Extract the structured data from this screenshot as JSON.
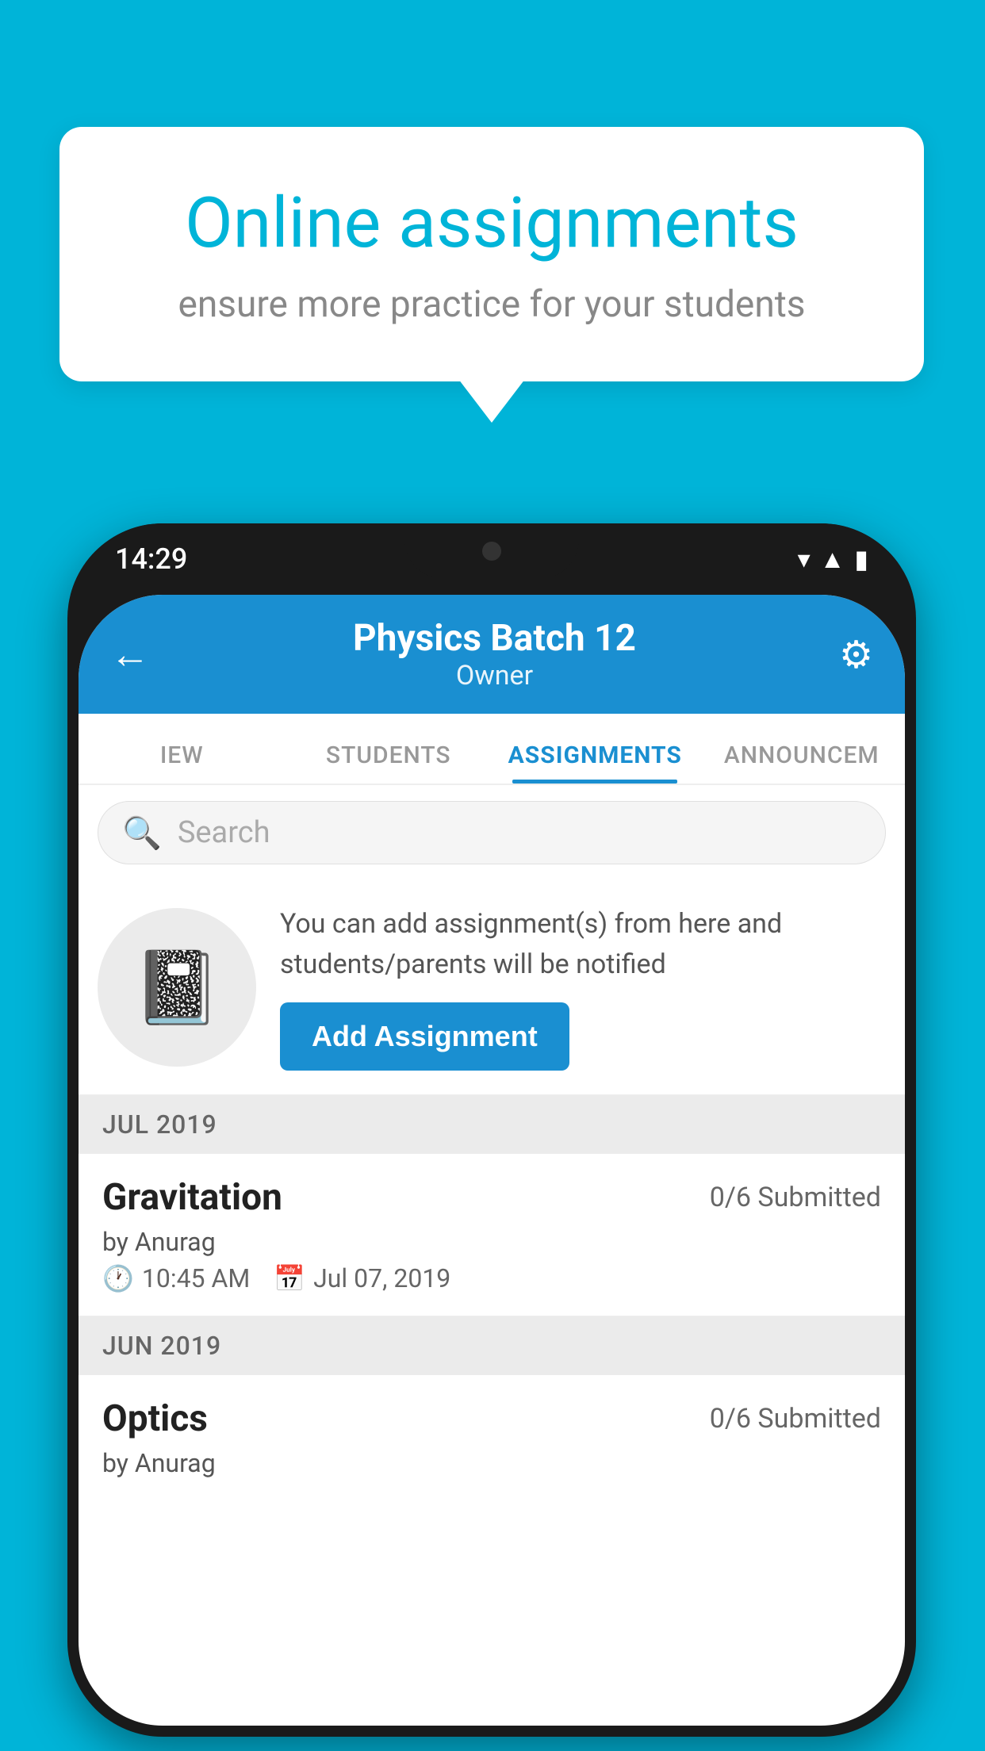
{
  "background_color": "#00b4d8",
  "speech_bubble": {
    "title": "Online assignments",
    "subtitle": "ensure more practice for your students"
  },
  "phone": {
    "status_bar": {
      "time": "14:29"
    },
    "header": {
      "title": "Physics Batch 12",
      "subtitle": "Owner",
      "back_label": "←",
      "settings_label": "⚙"
    },
    "tabs": [
      {
        "label": "IEW",
        "active": false
      },
      {
        "label": "STUDENTS",
        "active": false
      },
      {
        "label": "ASSIGNMENTS",
        "active": true
      },
      {
        "label": "ANNOUNCEM",
        "active": false
      }
    ],
    "search": {
      "placeholder": "Search"
    },
    "promo": {
      "description": "You can add assignment(s) from here and students/parents will be notified",
      "button_label": "Add Assignment"
    },
    "sections": [
      {
        "header": "JUL 2019",
        "assignments": [
          {
            "name": "Gravitation",
            "submitted": "0/6 Submitted",
            "by": "by Anurag",
            "time": "10:45 AM",
            "date": "Jul 07, 2019"
          }
        ]
      },
      {
        "header": "JUN 2019",
        "assignments": [
          {
            "name": "Optics",
            "submitted": "0/6 Submitted",
            "by": "by Anurag",
            "time": "",
            "date": ""
          }
        ]
      }
    ]
  }
}
